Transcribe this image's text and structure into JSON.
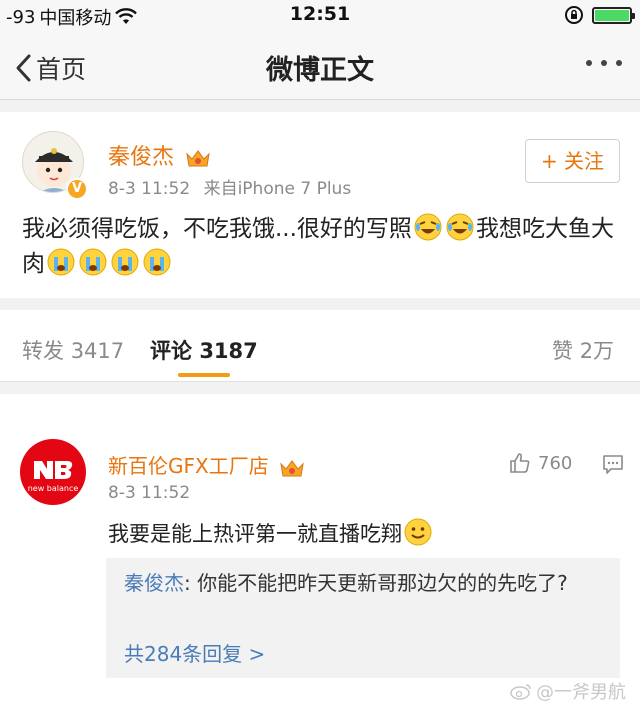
{
  "status_bar": {
    "signal": "-93",
    "carrier": "中国移动",
    "time": "12:51"
  },
  "nav": {
    "back_label": "首页",
    "title": "微博正文"
  },
  "post": {
    "author": "秦俊杰",
    "time": "8-3 11:52",
    "source": "来自iPhone 7 Plus",
    "follow_label": "+ 关注",
    "text_part1": "我必须得吃饭，不吃我饿...很好的写照",
    "text_part2": "我想吃大鱼大肉",
    "badge": "V"
  },
  "tabs": {
    "repost_label": "转发",
    "repost_count": "3417",
    "comment_label": "评论",
    "comment_count": "3187",
    "like_label": "赞",
    "like_count": "2万"
  },
  "comment": {
    "author": "新百伦GFX工厂店",
    "time": "8-3 11:52",
    "likes": "760",
    "text": "我要是能上热评第一就直播吃翔",
    "avatar_text": "new balance",
    "reply": {
      "name": "秦俊杰",
      "text": ": 你能不能把昨天更新哥那边欠的的先吃了?",
      "more": "共284条回复 >"
    }
  },
  "watermark": "@一斧男航",
  "colors": {
    "accent": "#e8750e",
    "link": "#4a7cb8",
    "tab_underline": "#f39c12"
  }
}
